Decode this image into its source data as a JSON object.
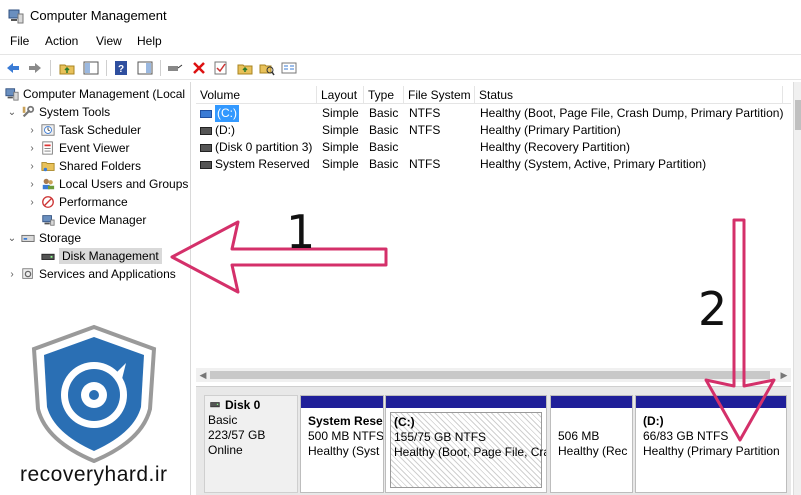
{
  "window": {
    "title": "Computer Management"
  },
  "menu": [
    "File",
    "Action",
    "View",
    "Help"
  ],
  "toolbar": {
    "icons": [
      "back-arrow-icon",
      "forward-arrow-icon",
      "up-folder-icon",
      "show-hide-tree-icon",
      "help-icon",
      "console-tree-icon",
      "connect-icon",
      "delete-icon",
      "check-icon",
      "yellow-folder-icon",
      "search-folder-icon",
      "properties-icon"
    ]
  },
  "tree": {
    "root": "Computer Management (Local",
    "system_tools": "System Tools",
    "task_scheduler": "Task Scheduler",
    "event_viewer": "Event Viewer",
    "shared_folders": "Shared Folders",
    "local_users": "Local Users and Groups",
    "performance": "Performance",
    "device_manager": "Device Manager",
    "storage": "Storage",
    "disk_management": "Disk Management",
    "services": "Services and Applications"
  },
  "volumes": {
    "headers": {
      "volume": "Volume",
      "layout": "Layout",
      "type": "Type",
      "fs": "File System",
      "status": "Status"
    },
    "rows": [
      {
        "volume": "(C:)",
        "layout": "Simple",
        "type": "Basic",
        "fs": "NTFS",
        "status": "Healthy (Boot, Page File, Crash Dump, Primary Partition)"
      },
      {
        "volume": "(D:)",
        "layout": "Simple",
        "type": "Basic",
        "fs": "NTFS",
        "status": "Healthy (Primary Partition)"
      },
      {
        "volume": "(Disk 0 partition 3)",
        "layout": "Simple",
        "type": "Basic",
        "fs": "",
        "status": "Healthy (Recovery Partition)"
      },
      {
        "volume": "System Reserved",
        "layout": "Simple",
        "type": "Basic",
        "fs": "NTFS",
        "status": "Healthy (System, Active, Primary Partition)"
      }
    ]
  },
  "disk": {
    "name": "Disk 0",
    "type": "Basic",
    "size": "223/57 GB",
    "state": "Online",
    "partitions": [
      {
        "title": "System Rese",
        "size": "500 MB NTFS",
        "status": "Healthy (Syst"
      },
      {
        "title": "(C:)",
        "size": "155/75 GB NTFS",
        "status": "Healthy (Boot, Page File, Cra"
      },
      {
        "title": "",
        "size": "506 MB",
        "status": "Healthy (Rec"
      },
      {
        "title": "(D:)",
        "size": "66/83 GB NTFS",
        "status": "Healthy (Primary Partition"
      }
    ]
  },
  "annotations": {
    "one": "1",
    "two": "2"
  },
  "watermark": {
    "text": "recoveryhard.ir"
  },
  "colors": {
    "partition_bar": "#1f1f99",
    "arrow": "#d4306a",
    "selection": "#3399ff",
    "shield": "#2a6fb4"
  }
}
